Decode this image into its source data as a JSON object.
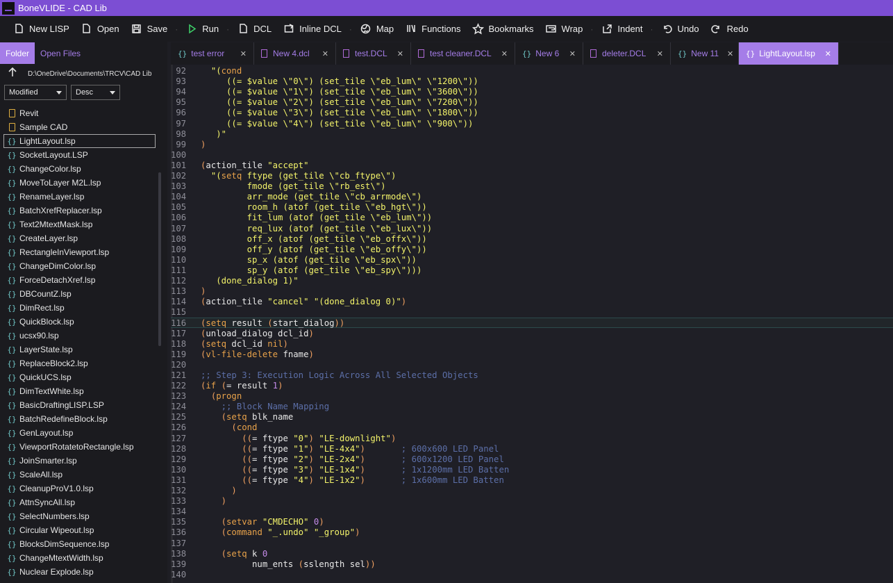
{
  "window": {
    "title": "BoneVLIDE - CAD Lib"
  },
  "toolbar": {
    "buttons": [
      {
        "label": "New LISP",
        "icon": "new-lisp-icon"
      },
      {
        "label": "Open",
        "icon": "open-file-icon"
      },
      {
        "label": "Save",
        "icon": "save-icon"
      },
      {
        "label": "Run",
        "icon": "run-icon"
      },
      {
        "label": "DCL",
        "icon": "dcl-icon"
      },
      {
        "label": "Inline DCL",
        "icon": "inline-dcl-icon"
      },
      {
        "label": "Map",
        "icon": "map-globe-icon"
      },
      {
        "label": "Functions",
        "icon": "functions-icon"
      },
      {
        "label": "Bookmarks",
        "icon": "bookmark-star-icon"
      },
      {
        "label": "Wrap",
        "icon": "wrap-icon"
      },
      {
        "label": "Indent",
        "icon": "indent-icon"
      },
      {
        "label": "Undo",
        "icon": "undo-icon"
      },
      {
        "label": "Redo",
        "icon": "redo-icon"
      }
    ]
  },
  "sidebar": {
    "tabs": [
      "Folder",
      "Open Files"
    ],
    "active_tab": "Folder",
    "path": "D:\\OneDrive\\Documents\\TRCV\\CAD Lib",
    "sort_field": "Modified",
    "sort_order": "Desc",
    "folders": [
      "Revit",
      "Sample CAD"
    ],
    "files": [
      "LightLayout.lsp",
      "SocketLayout.LSP",
      "ChangeColor.lsp",
      "MoveToLayer M2L.lsp",
      "RenameLayer.lsp",
      "BatchXrefReplacer.lsp",
      "Text2MtextMask.lsp",
      "CreateLayer.lsp",
      "RectangleInViewport.lsp",
      "ChangeDimColor.lsp",
      "ForceDetachXref.lsp",
      "DBCountZ.lsp",
      "DimRect.lsp",
      "QuickBlock.lsp",
      "ucsx90.lsp",
      "LayerState.lsp",
      "ReplaceBlock2.lsp",
      "QuickUCS.lsp",
      "DimTextWhite.lsp",
      "BasicDraftingLISP.LSP",
      "BatchRedefineBlock.lsp",
      "GenLayout.lsp",
      "ViewportRotatetoRectangle.lsp",
      "JoinSmarter.lsp",
      "ScaleAll.lsp",
      "CleanupProV1.0.lsp",
      "AttnSyncAll.lsp",
      "SelectNumbers.lsp",
      "Circular Wipeout.lsp",
      "BlocksDimSequence.lsp",
      "ChangeMtextWidth.lsp",
      "Nuclear Explode.lsp"
    ],
    "selected_file": "LightLayout.lsp"
  },
  "tabs": [
    {
      "label": "test error",
      "type": "lsp"
    },
    {
      "label": "New 4.dcl",
      "type": "dcl"
    },
    {
      "label": "test.DCL",
      "type": "dcl"
    },
    {
      "label": "test cleaner.DCL",
      "type": "dcl"
    },
    {
      "label": "New 6",
      "type": "lsp"
    },
    {
      "label": "deleter.DCL",
      "type": "dcl"
    },
    {
      "label": "New 11",
      "type": "lsp"
    },
    {
      "label": "LightLayout.lsp",
      "type": "lsp",
      "active": true
    }
  ],
  "editor": {
    "current_line": 116,
    "lines": [
      {
        "n": 92,
        "html": "  <span class=\"s\">\"(</span><span class=\"k\">cond</span>"
      },
      {
        "n": 93,
        "html": "     <span class=\"s\">((= $value \\\"0\\\") (set_tile \\\"eb_lum\\\" \\\"1200\\\"))</span>"
      },
      {
        "n": 94,
        "html": "     <span class=\"s\">((= $value \\\"1\\\") (set_tile \\\"eb_lum\\\" \\\"3600\\\"))</span>"
      },
      {
        "n": 95,
        "html": "     <span class=\"s\">((= $value \\\"2\\\") (set_tile \\\"eb_lum\\\" \\\"7200\\\"))</span>"
      },
      {
        "n": 96,
        "html": "     <span class=\"s\">((= $value \\\"3\\\") (set_tile \\\"eb_lum\\\" \\\"1800\\\"))</span>"
      },
      {
        "n": 97,
        "html": "     <span class=\"s\">((= $value \\\"4\\\") (set_tile \\\"eb_lum\\\" \\\"900\\\"))</span>"
      },
      {
        "n": 98,
        "html": "   <span class=\"s\">)\"</span>"
      },
      {
        "n": 99,
        "html": "<span class=\"p\">)</span>"
      },
      {
        "n": 100,
        "html": ""
      },
      {
        "n": 101,
        "html": "<span class=\"p\">(</span>action_tile <span class=\"s\">\"accept\"</span>"
      },
      {
        "n": 102,
        "html": "  <span class=\"s\">\"(</span><span class=\"k\">setq</span><span class=\"s\"> ftype (get_tile \\\"cb_ftype\\\")</span>"
      },
      {
        "n": 103,
        "html": "         <span class=\"s\">fmode (get_tile \\\"rb_est\\\")</span>"
      },
      {
        "n": 104,
        "html": "         <span class=\"s\">arr_mode (get_tile \\\"cb_arrmode\\\")</span>"
      },
      {
        "n": 105,
        "html": "         <span class=\"s\">room_h (atof (get_tile \\\"eb_hgt\\\"))</span>"
      },
      {
        "n": 106,
        "html": "         <span class=\"s\">fit_lum (atof (get_tile \\\"eb_lum\\\"))</span>"
      },
      {
        "n": 107,
        "html": "         <span class=\"s\">req_lux (atof (get_tile \\\"eb_lux\\\"))</span>"
      },
      {
        "n": 108,
        "html": "         <span class=\"s\">off_x (atof (get_tile \\\"eb_offx\\\"))</span>"
      },
      {
        "n": 109,
        "html": "         <span class=\"s\">off_y (atof (get_tile \\\"eb_offy\\\"))</span>"
      },
      {
        "n": 110,
        "html": "         <span class=\"s\">sp_x (atof (get_tile \\\"eb_spx\\\"))</span>"
      },
      {
        "n": 111,
        "html": "         <span class=\"s\">sp_y (atof (get_tile \\\"eb_spy\\\")))</span>"
      },
      {
        "n": 112,
        "html": "   <span class=\"s\">(done_dialog 1)\"</span>"
      },
      {
        "n": 113,
        "html": "<span class=\"p\">)</span>"
      },
      {
        "n": 114,
        "html": "<span class=\"p\">(</span>action_tile <span class=\"s\">\"cancel\"</span> <span class=\"s\">\"(done_dialog 0)\"</span><span class=\"p\">)</span>"
      },
      {
        "n": 115,
        "html": ""
      },
      {
        "n": 116,
        "html": "<span class=\"p\">(</span><span class=\"k\">setq</span> result <span class=\"p\">(</span>start_dialog<span class=\"p\">))</span>"
      },
      {
        "n": 117,
        "html": "<span class=\"p\">(</span>unload_dialog dcl_id<span class=\"p\">)</span>"
      },
      {
        "n": 118,
        "html": "<span class=\"p\">(</span><span class=\"k\">setq</span> dcl_id <span class=\"k\">nil</span><span class=\"p\">)</span>"
      },
      {
        "n": 119,
        "html": "<span class=\"p\">(</span><span class=\"k\">vl-file-delete</span> fname<span class=\"p\">)</span>"
      },
      {
        "n": 120,
        "html": ""
      },
      {
        "n": 121,
        "html": "<span class=\"c\">;; Step 3: Execution Logic Across All Selected Objects</span>"
      },
      {
        "n": 122,
        "html": "<span class=\"p\">(</span><span class=\"k\">if</span> <span class=\"p\">(</span>= result <span class=\"n\">1</span><span class=\"p\">)</span>"
      },
      {
        "n": 123,
        "html": "  <span class=\"p\">(</span><span class=\"k\">progn</span>"
      },
      {
        "n": 124,
        "html": "    <span class=\"c\">;; Block Name Mapping</span>"
      },
      {
        "n": 125,
        "html": "    <span class=\"p\">(</span><span class=\"k\">setq</span> blk_name"
      },
      {
        "n": 126,
        "html": "      <span class=\"p\">(</span><span class=\"k\">cond</span>"
      },
      {
        "n": 127,
        "html": "        <span class=\"p\">((</span>= ftype <span class=\"s\">\"0\"</span><span class=\"p\">)</span> <span class=\"s\">\"LE-downlight\"</span><span class=\"p\">)</span>"
      },
      {
        "n": 128,
        "html": "        <span class=\"p\">((</span>= ftype <span class=\"s\">\"1\"</span><span class=\"p\">)</span> <span class=\"s\">\"LE-4x4\"</span><span class=\"p\">)</span>       <span class=\"c\">; 600x600 LED Panel</span>"
      },
      {
        "n": 129,
        "html": "        <span class=\"p\">((</span>= ftype <span class=\"s\">\"2\"</span><span class=\"p\">)</span> <span class=\"s\">\"LE-2x4\"</span><span class=\"p\">)</span>       <span class=\"c\">; 600x1200 LED Panel</span>"
      },
      {
        "n": 130,
        "html": "        <span class=\"p\">((</span>= ftype <span class=\"s\">\"3\"</span><span class=\"p\">)</span> <span class=\"s\">\"LE-1x4\"</span><span class=\"p\">)</span>       <span class=\"c\">; 1x1200mm LED Batten</span>"
      },
      {
        "n": 131,
        "html": "        <span class=\"p\">((</span>= ftype <span class=\"s\">\"4\"</span><span class=\"p\">)</span> <span class=\"s\">\"LE-1x2\"</span><span class=\"p\">)</span>       <span class=\"c\">; 1x600mm LED Batten</span>"
      },
      {
        "n": 132,
        "html": "      <span class=\"p\">)</span>"
      },
      {
        "n": 133,
        "html": "    <span class=\"p\">)</span>"
      },
      {
        "n": 134,
        "html": ""
      },
      {
        "n": 135,
        "html": "    <span class=\"p\">(</span><span class=\"k\">setvar</span> <span class=\"s\">\"CMDECHO\"</span> <span class=\"n\">0</span><span class=\"p\">)</span>"
      },
      {
        "n": 136,
        "html": "    <span class=\"p\">(</span><span class=\"k\">command</span> <span class=\"s\">\"_.undo\"</span> <span class=\"s\">\"_group\"</span><span class=\"p\">)</span>"
      },
      {
        "n": 137,
        "html": ""
      },
      {
        "n": 138,
        "html": "    <span class=\"p\">(</span><span class=\"k\">setq</span> k <span class=\"n\">0</span>"
      },
      {
        "n": 139,
        "html": "          num_ents <span class=\"p\">(</span>sslength sel<span class=\"p\">))</span>"
      },
      {
        "n": 140,
        "html": ""
      }
    ]
  }
}
